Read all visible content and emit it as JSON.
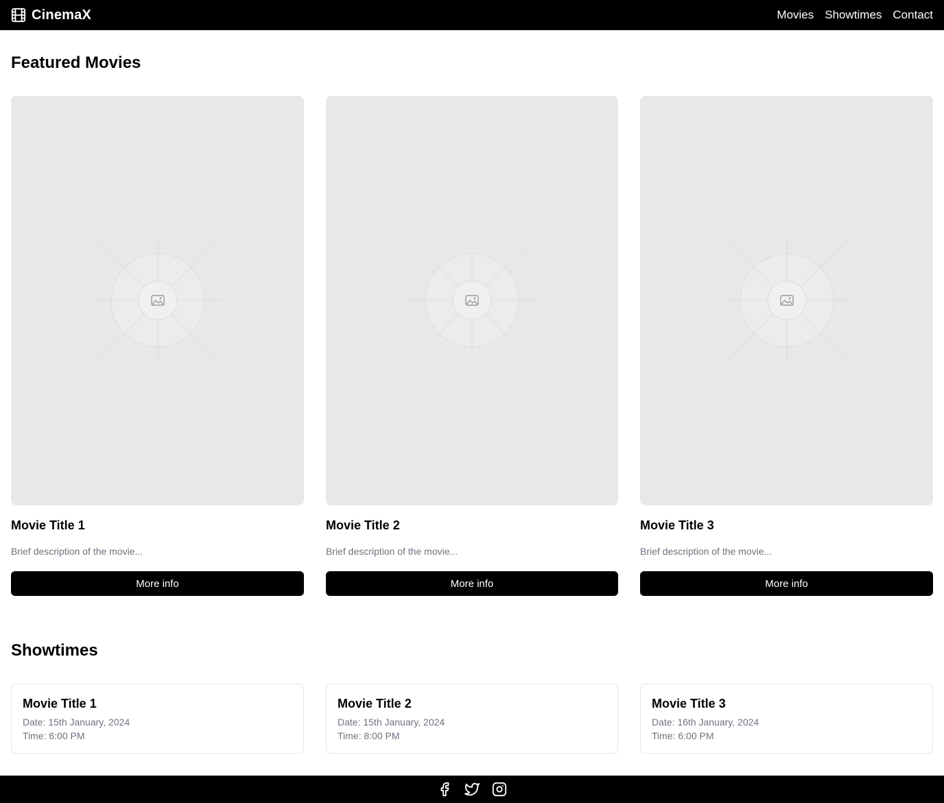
{
  "header": {
    "brand": "CinemaX",
    "brand_icon": "film-icon",
    "nav": [
      "Movies",
      "Showtimes",
      "Contact"
    ]
  },
  "featured": {
    "title": "Featured Movies",
    "movies": [
      {
        "title": "Movie Title 1",
        "description": "Brief description of the movie...",
        "button": "More info",
        "poster_icon": "image-placeholder-icon"
      },
      {
        "title": "Movie Title 2",
        "description": "Brief description of the movie...",
        "button": "More info",
        "poster_icon": "image-placeholder-icon"
      },
      {
        "title": "Movie Title 3",
        "description": "Brief description of the movie...",
        "button": "More info",
        "poster_icon": "image-placeholder-icon"
      }
    ]
  },
  "showtimes": {
    "title": "Showtimes",
    "items": [
      {
        "title": "Movie Title 1",
        "date": "Date: 15th January, 2024",
        "time": "Time: 6:00 PM"
      },
      {
        "title": "Movie Title 2",
        "date": "Date: 15th January, 2024",
        "time": "Time: 8:00 PM"
      },
      {
        "title": "Movie Title 3",
        "date": "Date: 16th January, 2024",
        "time": "Time: 6:00 PM"
      }
    ]
  },
  "footer": {
    "socials": [
      "facebook-icon",
      "twitter-icon",
      "instagram-icon"
    ]
  },
  "colors": {
    "nav_bg": "#000000",
    "nav_text": "#ffffff",
    "poster_bg": "#e8e8e8",
    "button_bg": "#000000",
    "muted_text": "#6b7280",
    "card_border": "#e5e7eb"
  }
}
